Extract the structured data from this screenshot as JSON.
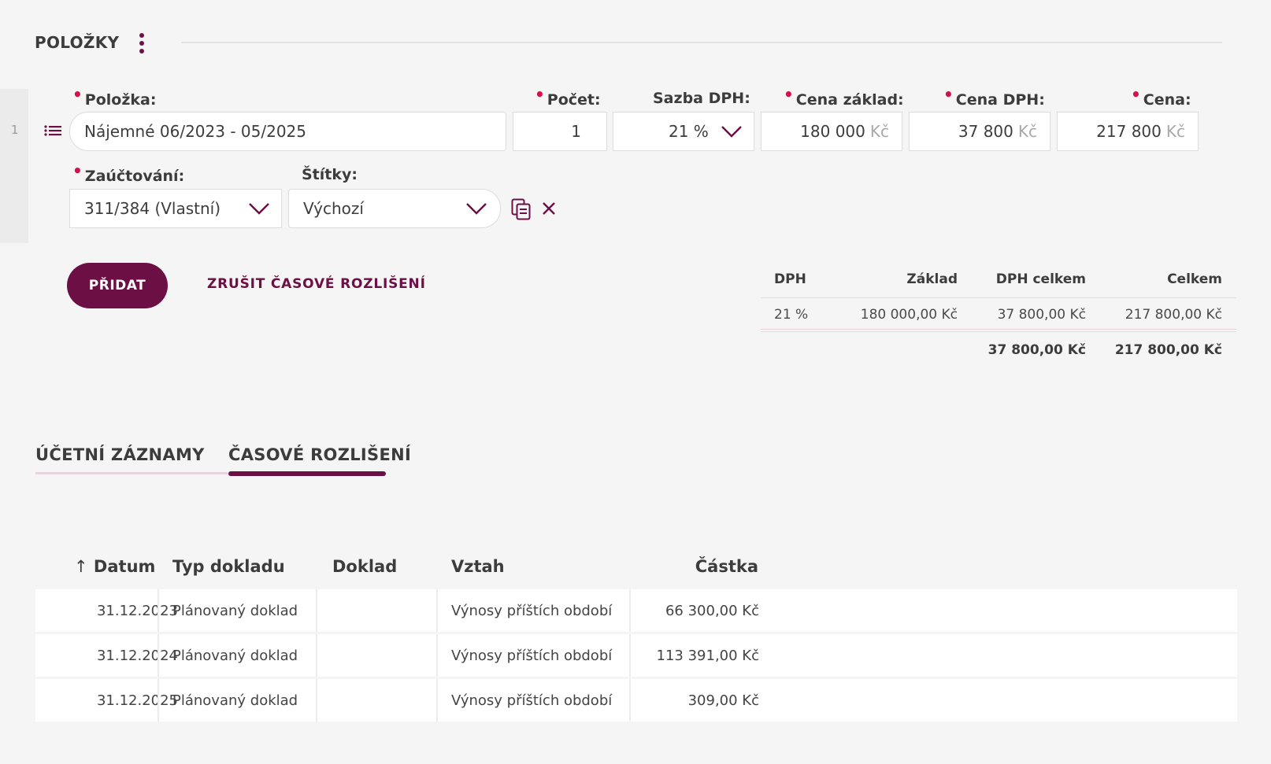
{
  "section": {
    "title": "POLOŽKY"
  },
  "row": {
    "number": "1",
    "labels": {
      "polozka": "Položka:",
      "pocet": "Počet:",
      "sazba": "Sazba DPH:",
      "cena_zaklad": "Cena základ:",
      "cena_dph": "Cena DPH:",
      "cena": "Cena:",
      "zauctovani": "Zaúčtování:",
      "stitky": "Štítky:"
    },
    "values": {
      "polozka": "Nájemné 06/2023 - 05/2025",
      "pocet": "1",
      "sazba": "21 %",
      "cena_zaklad": "180 000",
      "cena_dph": "37 800",
      "cena": "217 800",
      "currency": "Kč",
      "zauctovani": "311/384 (Vlastní)",
      "stitky": "Výchozí"
    }
  },
  "actions": {
    "add": "PŘIDAT",
    "cancel_accrual": "ZRUŠIT ČASOVÉ ROZLIŠENÍ"
  },
  "summary": {
    "headers": [
      "DPH",
      "Základ",
      "DPH celkem",
      "Celkem"
    ],
    "rows": [
      [
        "21 %",
        "180 000,00 Kč",
        "37 800,00 Kč",
        "217 800,00 Kč"
      ]
    ],
    "totals": {
      "dph_celkem": "37 800,00 Kč",
      "celkem": "217 800,00 Kč"
    }
  },
  "tabs": [
    {
      "label": "ÚČETNÍ ZÁZNAMY",
      "active": false
    },
    {
      "label": "ČASOVÉ ROZLIŠENÍ",
      "active": true
    }
  ],
  "table": {
    "headers": {
      "datum": "Datum",
      "typ": "Typ dokladu",
      "doklad": "Doklad",
      "vztah": "Vztah",
      "castka": "Částka"
    },
    "rows": [
      {
        "datum": "31.12.2023",
        "typ": "Plánovaný doklad",
        "doklad": "",
        "vztah": "Výnosy příštích období",
        "castka": "66 300,00 Kč"
      },
      {
        "datum": "31.12.2024",
        "typ": "Plánovaný doklad",
        "doklad": "",
        "vztah": "Výnosy příštích období",
        "castka": "113 391,00 Kč"
      },
      {
        "datum": "31.12.2025",
        "typ": "Plánovaný doklad",
        "doklad": "",
        "vztah": "Výnosy příštích období",
        "castka": "309,00 Kč"
      }
    ]
  },
  "colors": {
    "accent": "#6b0f44",
    "required": "#d0134f",
    "background": "#f5f5f5"
  },
  "icons": [
    "kebab-menu-icon",
    "drag-handle-icon",
    "chevron-down-icon",
    "copy-icon",
    "close-icon",
    "sort-ascending-icon"
  ]
}
